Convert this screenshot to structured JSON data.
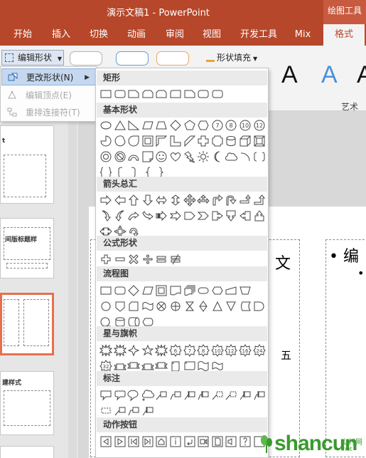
{
  "window": {
    "title": "演示文稿1 - PowerPoint",
    "context_tab_group": "绘图工具"
  },
  "ribbon_tabs": [
    "开始",
    "插入",
    "切换",
    "动画",
    "审阅",
    "视图",
    "开发工具",
    "Mix",
    "格式"
  ],
  "active_tab": "格式",
  "ribbon": {
    "edit_shape": "编辑形状",
    "shape_fill": "形状填充",
    "wordart_label": "艺术字",
    "wordart_glyph": "A"
  },
  "edit_shape_menu": [
    {
      "label": "更改形状(N)",
      "enabled": true,
      "highlighted": true,
      "has_submenu": true,
      "icon": "change-shape-icon"
    },
    {
      "label": "编辑顶点(E)",
      "enabled": false,
      "icon": "edit-points-icon"
    },
    {
      "label": "重排连接符(T)",
      "enabled": false,
      "icon": "reroute-connectors-icon"
    }
  ],
  "shape_categories": [
    {
      "name": "矩形",
      "count": 9
    },
    {
      "name": "基本形状",
      "count": 42
    },
    {
      "name": "箭头总汇",
      "count": 27
    },
    {
      "name": "公式形状",
      "count": 6
    },
    {
      "name": "流程图",
      "count": 28
    },
    {
      "name": "星与旗帜",
      "count": 20
    },
    {
      "name": "标注",
      "count": 16
    },
    {
      "name": "动作按钮",
      "count": 12
    }
  ],
  "basic_shape_digits": [
    "7",
    "8",
    "10",
    "12"
  ],
  "star_digits": [
    "6",
    "7",
    "8",
    "10",
    "12",
    "16",
    "24",
    "32"
  ],
  "slide_thumbnails": [
    {
      "text": "t"
    },
    {
      "text": "间版标题样"
    },
    {
      "text": ""
    },
    {
      "text": "建样式"
    }
  ],
  "slide": {
    "left_char": "文",
    "bullet": "• 编",
    "sub_bullet": "•",
    "char_five": "五"
  },
  "watermark": {
    "text": "shancun",
    "cn": "山村网",
    "net": ".net"
  },
  "colors": {
    "accent": "#b7472a",
    "wordart_blue": "#4a90d9"
  }
}
